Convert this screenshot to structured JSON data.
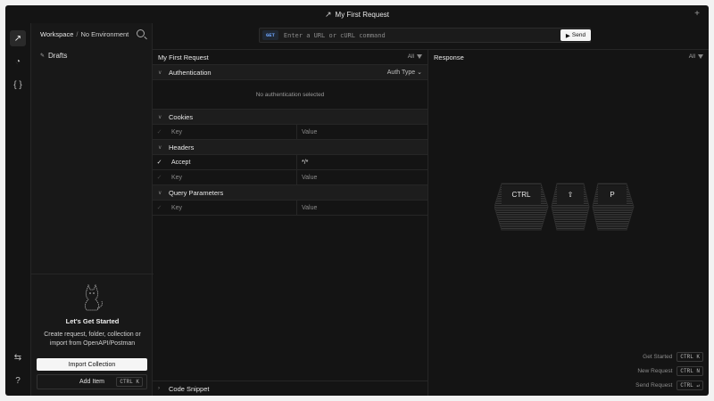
{
  "window": {
    "title": "My First Request"
  },
  "sidebar": {
    "workspace": "Workspace",
    "separator": "/",
    "environment": "No Environment",
    "drafts_label": "Drafts",
    "getting_started": {
      "title": "Let's Get Started",
      "description": "Create request, folder, collection or import from OpenAPI/Postman",
      "import_label": "Import Collection",
      "add_label": "Add Item",
      "add_shortcut": "CTRL K"
    }
  },
  "urlbar": {
    "method": "GET",
    "placeholder": "Enter a URL or cURL command",
    "send_label": "Send"
  },
  "request": {
    "title": "My First Request",
    "filter_label": "All",
    "auth": {
      "label": "Authentication",
      "type_label": "Auth Type",
      "empty": "No authentication selected"
    },
    "cookies": {
      "label": "Cookies",
      "key_placeholder": "Key",
      "value_placeholder": "Value"
    },
    "headers": {
      "label": "Headers",
      "rows": [
        {
          "key": "Accept",
          "value": "*/*"
        }
      ],
      "key_placeholder": "Key",
      "value_placeholder": "Value"
    },
    "query": {
      "label": "Query Parameters",
      "key_placeholder": "Key",
      "value_placeholder": "Value"
    },
    "snippet_label": "Code Snippet"
  },
  "response": {
    "title": "Response",
    "filter_label": "All",
    "keys": [
      "CTRL",
      "⇧",
      "P"
    ],
    "shortcuts": [
      {
        "label": "Get Started",
        "keys": "CTRL K"
      },
      {
        "label": "New Request",
        "keys": "CTRL N"
      },
      {
        "label": "Send Request",
        "keys": "CTRL ↵"
      }
    ]
  }
}
